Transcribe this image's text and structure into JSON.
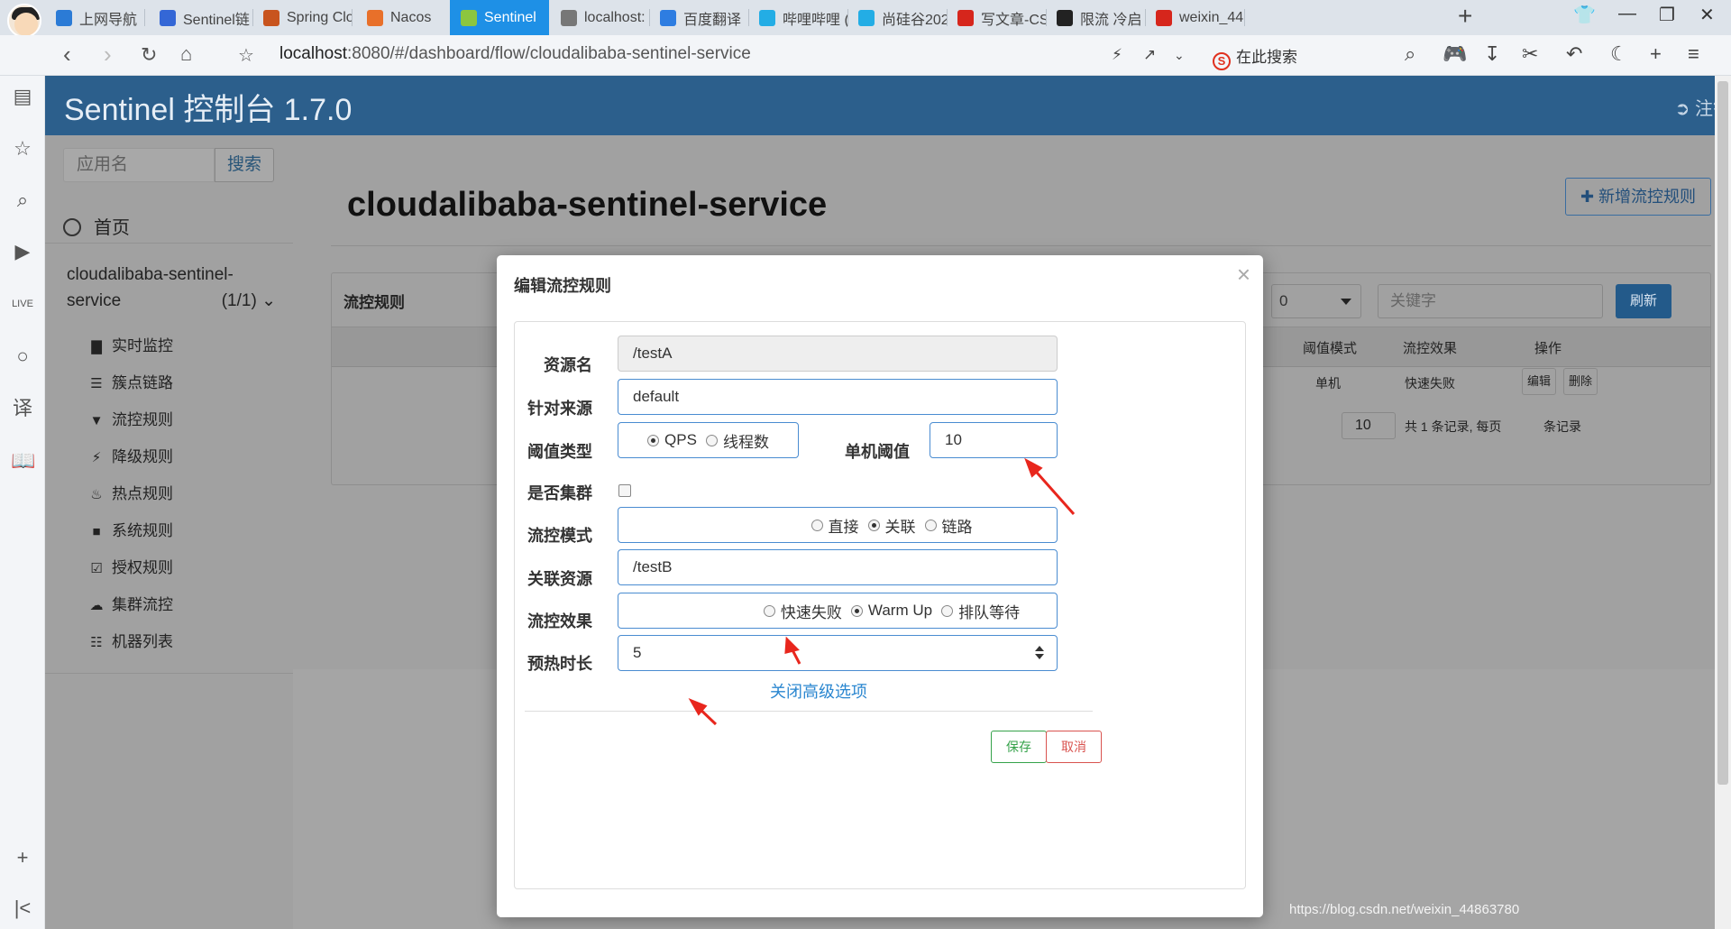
{
  "browser": {
    "tabs": [
      {
        "label": "上网导航",
        "icon_color": "#2b7bd6"
      },
      {
        "label": "Sentinel链",
        "icon_color": "#3467d6"
      },
      {
        "label": "Spring Clo",
        "icon_color": "#c8541e"
      },
      {
        "label": "Nacos",
        "icon_color": "#e8702a"
      },
      {
        "label": "Sentinel",
        "icon_color": "#8cc63f",
        "active": true
      },
      {
        "label": "localhost:",
        "icon_color": "#777777"
      },
      {
        "label": "百度翻译",
        "icon_color": "#2e7de1"
      },
      {
        "label": "哔哩哔哩 (",
        "icon_color": "#23ade5"
      },
      {
        "label": "尚硅谷202",
        "icon_color": "#23ade5"
      },
      {
        "label": "写文章-CS",
        "icon_color": "#d6261c"
      },
      {
        "label": "限流 冷启",
        "icon_color": "#222222"
      },
      {
        "label": "weixin_44",
        "icon_color": "#d6261c"
      }
    ],
    "tab_close": "×",
    "new_tab": "+",
    "url_host": "localhost",
    "url_rest": ":8080/#/dashboard/flow/cloudalibaba-sentinel-service",
    "search_placeholder": "在此搜索",
    "search_engine_logo": "S",
    "accent": "#1e90e6"
  },
  "app": {
    "title": "Sentinel 控制台 1.7.0",
    "logout": "注销",
    "search_placeholder": "应用名",
    "search_button": "搜索",
    "nav": {
      "home": "首页",
      "app_name": "cloudalibaba-sentinel-service",
      "app_count": "(1/1)",
      "items": [
        {
          "label": "实时监控",
          "icon": "bar-chart-icon"
        },
        {
          "label": "簇点链路",
          "icon": "list-icon"
        },
        {
          "label": "流控规则",
          "icon": "filter-icon"
        },
        {
          "label": "降级规则",
          "icon": "flash-icon"
        },
        {
          "label": "热点规则",
          "icon": "fire-icon"
        },
        {
          "label": "系统规则",
          "icon": "lock-icon"
        },
        {
          "label": "授权规则",
          "icon": "check-square-icon"
        },
        {
          "label": "集群流控",
          "icon": "cloud-icon"
        },
        {
          "label": "机器列表",
          "icon": "th-list-icon"
        }
      ]
    },
    "page_title": "cloudalibaba-sentinel-service",
    "add_rule_button": "新增流控规则",
    "panel": {
      "title": "流控规则",
      "select_value": "0",
      "keyword_placeholder": "关键字",
      "refresh_button": "刷新",
      "columns": [
        "阈值模式",
        "流控效果",
        "操作"
      ],
      "row": {
        "threshold_mode": "单机",
        "effect": "快速失败",
        "edit": "编辑",
        "delete": "删除"
      },
      "pager": {
        "total": "共 1 条记录, 每页",
        "page_size": "10",
        "suffix": "条记录"
      }
    }
  },
  "modal": {
    "title": "编辑流控规则",
    "close": "×",
    "fields": {
      "resource_label": "资源名",
      "resource_value": "/testA",
      "origin_label": "针对来源",
      "origin_value": "default",
      "threshold_type_label": "阈值类型",
      "threshold_type_options": [
        "QPS",
        "线程数"
      ],
      "threshold_type_selected": "QPS",
      "threshold_label": "单机阈值",
      "threshold_value": "10",
      "cluster_label": "是否集群",
      "cluster_checked": false,
      "mode_label": "流控模式",
      "mode_options": [
        "直接",
        "关联",
        "链路"
      ],
      "mode_selected": "关联",
      "ref_resource_label": "关联资源",
      "ref_resource_value": "/testB",
      "effect_label": "流控效果",
      "effect_options": [
        "快速失败",
        "Warm Up",
        "排队等待"
      ],
      "effect_selected": "Warm Up",
      "warmup_label": "预热时长",
      "warmup_value": "5"
    },
    "advanced_link": "关闭高级选项",
    "save_button": "保存",
    "cancel_button": "取消",
    "colors": {
      "field_border": "#4a8cd1",
      "save": "#35a24a",
      "cancel": "#d9534f",
      "link": "#2b87d0",
      "annotation_arrow": "#e8261d"
    }
  },
  "watermark": "https://blog.csdn.net/weixin_44863780"
}
